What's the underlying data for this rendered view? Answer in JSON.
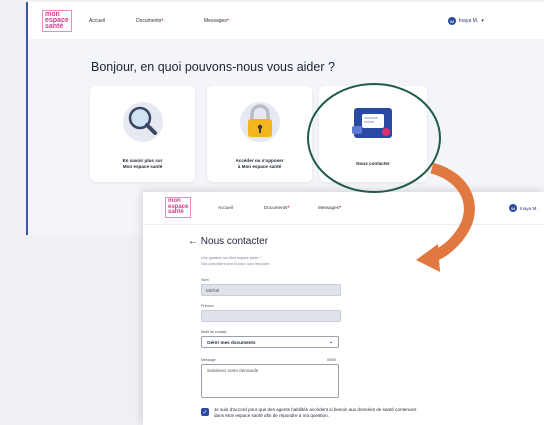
{
  "back": {
    "logo": [
      "mon",
      "espace",
      "santé"
    ],
    "nav": {
      "home": "Accueil",
      "documents": "Documents",
      "messages": "Messages",
      "badge": "•"
    },
    "user": {
      "initial": "IM",
      "name": "Inaya M.",
      "chevron": "▾"
    },
    "greeting": "Bonjour, en quoi pouvons-nous vous aider ?",
    "cards": [
      {
        "label_line1": "En savoir plus sur",
        "label_line2": "Mon espace santé",
        "icon": "magnifier-icon"
      },
      {
        "label_line1": "Accéder ou s'opposer",
        "label_line2": "à Mon espace santé",
        "icon": "padlock-icon"
      },
      {
        "label_line1": "Nous contacter",
        "label_line2": "",
        "icon": "contact-icon"
      }
    ]
  },
  "front": {
    "logo": [
      "mon",
      "espace",
      "santé"
    ],
    "nav": {
      "home": "Accueil",
      "documents": "Documents",
      "messages": "Messages",
      "badge": "•"
    },
    "user": {
      "initial": "IM",
      "name": "Inaya M."
    },
    "back_arrow": "←",
    "title": "Nous contacter",
    "intro_line1": "Une question sur Mon espace santé ?",
    "intro_line2": "Nos conseillers sont là pour vous répondre.",
    "nom_label": "Nom",
    "nom_value": "Michel",
    "prenom_label": "Prénom",
    "prenom_value": "",
    "motif_label": "Motif de contact",
    "motif_value": "Gérer mes documents",
    "motif_chevron": "⌄",
    "message_label": "Message",
    "message_counter": "0/500",
    "message_placeholder": "Saisissez votre demande",
    "consent_check": "✓",
    "consent_line1": "Je suis d'accord pour que des agents habilités accèdent si besoin aux données de santé contenues",
    "consent_line2": "dans Mon espace santé afin de répondre à ma question."
  },
  "colors": {
    "circle": "#1f5a4a",
    "arrow": "#e07840",
    "brand_blue": "#2a4aa2",
    "logo_pink": "#d63c8a"
  }
}
